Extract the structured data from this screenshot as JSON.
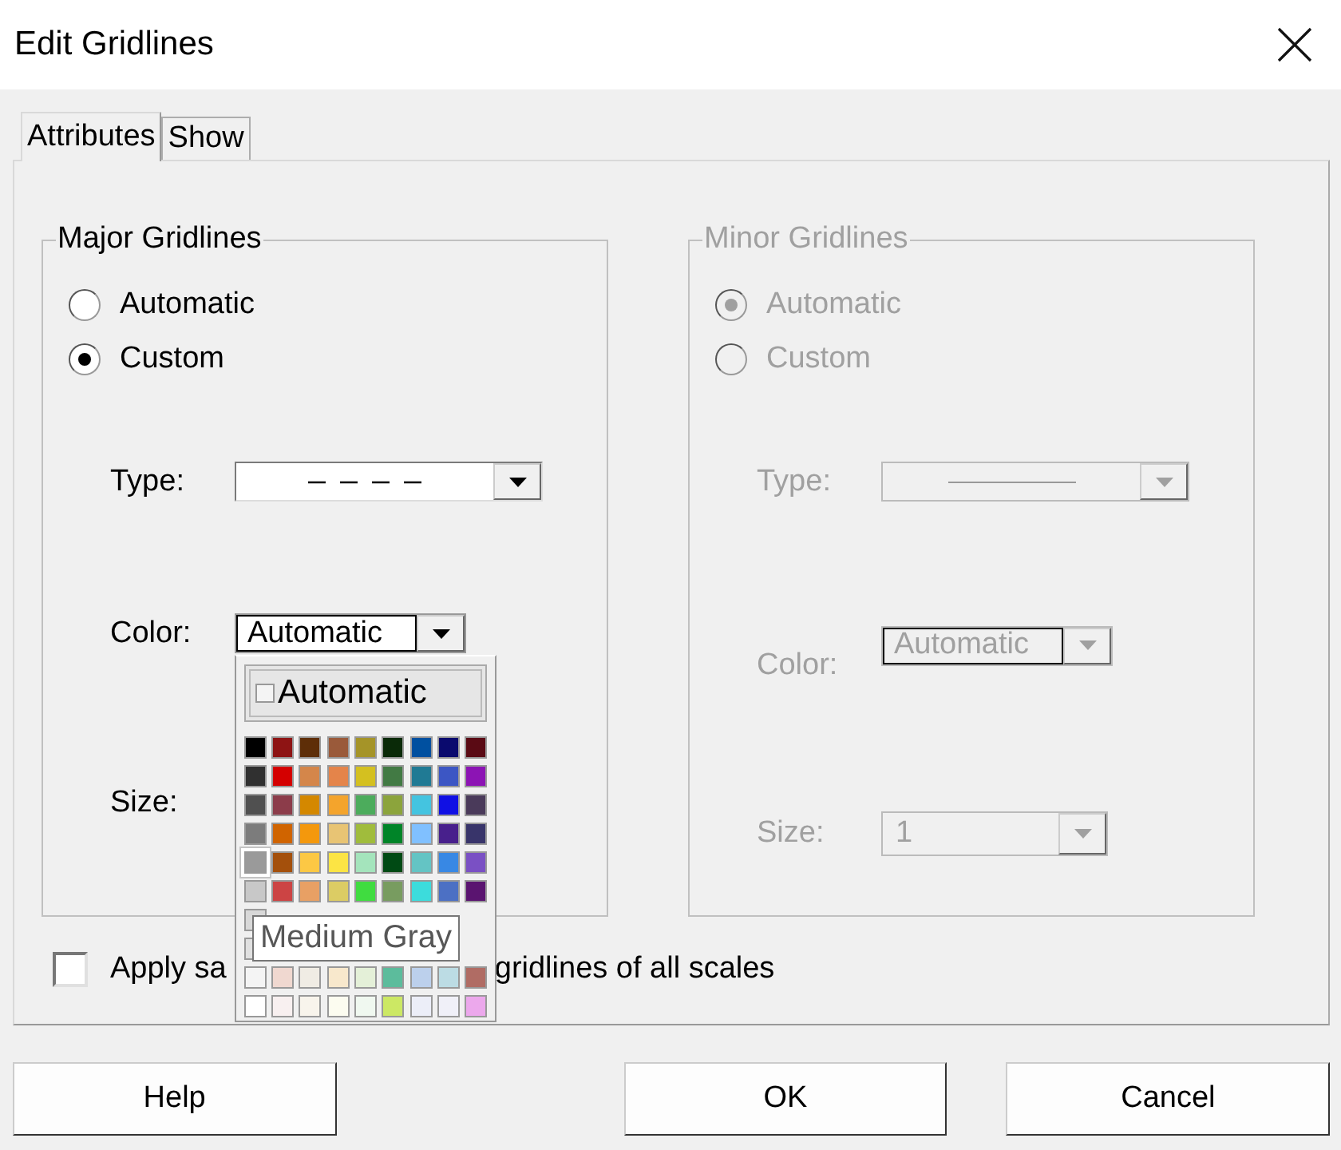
{
  "window": {
    "title": "Edit Gridlines"
  },
  "tabs": [
    {
      "label": "Attributes",
      "selected": true
    },
    {
      "label": "Show",
      "selected": false
    }
  ],
  "groups": [
    {
      "title": "Major Gridlines",
      "disabled": false,
      "options": [
        {
          "label": "Automatic",
          "selected": false
        },
        {
          "label": "Custom",
          "selected": true
        }
      ],
      "type": {
        "label": "Type:",
        "dashed": true
      },
      "color": {
        "label": "Color:",
        "value": "Automatic",
        "expanded": true
      },
      "size": {
        "label": "Size:"
      }
    },
    {
      "title": "Minor Gridlines",
      "disabled": true,
      "options": [
        {
          "label": "Automatic",
          "selected": true
        },
        {
          "label": "Custom",
          "selected": false
        }
      ],
      "type": {
        "label": "Type:",
        "dashed": false
      },
      "color": {
        "label": "Color:",
        "value": "Automatic",
        "expanded": false
      },
      "size": {
        "label": "Size:",
        "value": "1"
      }
    }
  ],
  "color_popup": {
    "automatic_label": "Automatic",
    "tooltip": "Medium Gray",
    "rows": [
      [
        {
          "color": "#000000",
          "selected": false
        },
        {
          "color": "#8e1414",
          "selected": false
        },
        {
          "color": "#5e2e08",
          "selected": false
        },
        {
          "color": "#9a5a3a",
          "selected": false
        },
        {
          "color": "#a59428",
          "selected": false
        },
        {
          "color": "#0a2a08",
          "selected": false
        },
        {
          "color": "#0050a0",
          "selected": false
        },
        {
          "color": "#0a0a6e",
          "selected": false
        },
        {
          "color": "#5a0a14",
          "selected": false
        }
      ],
      [
        {
          "color": "#303030",
          "selected": false
        },
        {
          "color": "#d40000",
          "selected": false
        },
        {
          "color": "#d4864a",
          "selected": false
        },
        {
          "color": "#e4844a",
          "selected": false
        },
        {
          "color": "#d4c020",
          "selected": false
        },
        {
          "color": "#427a44",
          "selected": false
        },
        {
          "color": "#207a94",
          "selected": false
        },
        {
          "color": "#3c56c4",
          "selected": false
        },
        {
          "color": "#8c14b4",
          "selected": false
        }
      ],
      [
        {
          "color": "#505050",
          "selected": false
        },
        {
          "color": "#8c3c4a",
          "selected": false
        },
        {
          "color": "#d48800",
          "selected": false
        },
        {
          "color": "#f4a42c",
          "selected": false
        },
        {
          "color": "#4cac5c",
          "selected": false
        },
        {
          "color": "#8ca43c",
          "selected": false
        },
        {
          "color": "#44c4e0",
          "selected": false
        },
        {
          "color": "#1010e4",
          "selected": false
        },
        {
          "color": "#4a3a5a",
          "selected": false
        }
      ],
      [
        {
          "color": "#7c7c7c",
          "selected": false
        },
        {
          "color": "#d06400",
          "selected": false
        },
        {
          "color": "#f4980c",
          "selected": false
        },
        {
          "color": "#e8c474",
          "selected": false
        },
        {
          "color": "#a0bc3c",
          "selected": false
        },
        {
          "color": "#008428",
          "selected": false
        },
        {
          "color": "#80c0ff",
          "selected": false
        },
        {
          "color": "#48208c",
          "selected": false
        },
        {
          "color": "#38346a",
          "selected": false
        }
      ],
      [
        {
          "color": "#9a9a9a",
          "selected": true
        },
        {
          "color": "#a4500c",
          "selected": false
        },
        {
          "color": "#fcc844",
          "selected": false
        },
        {
          "color": "#fce444",
          "selected": false
        },
        {
          "color": "#a4e4bc",
          "selected": false
        },
        {
          "color": "#004a14",
          "selected": false
        },
        {
          "color": "#64c4c4",
          "selected": false
        },
        {
          "color": "#3888e4",
          "selected": false
        },
        {
          "color": "#7a50c4",
          "selected": false
        }
      ],
      [
        {
          "color": "#c8c8c8",
          "selected": false
        },
        {
          "color": "#cc4444",
          "selected": false
        },
        {
          "color": "#e8a064",
          "selected": false
        },
        {
          "color": "#dccc64",
          "selected": false
        },
        {
          "color": "#40dc40",
          "selected": false
        },
        {
          "color": "#789c60",
          "selected": false
        },
        {
          "color": "#3cdcdc",
          "selected": false
        },
        {
          "color": "#4c70c4",
          "selected": false
        },
        {
          "color": "#5a1470",
          "selected": false
        }
      ],
      [
        {
          "color": "#d8d8d8",
          "selected": false
        }
      ],
      [
        {
          "color": "#e0e0e0",
          "selected": false
        }
      ],
      [
        {
          "color": "#f4f4f4",
          "selected": false
        },
        {
          "color": "#f0d8d0",
          "selected": false
        },
        {
          "color": "#f0ece4",
          "selected": false
        },
        {
          "color": "#f8e8cc",
          "selected": false
        },
        {
          "color": "#e4f0d8",
          "selected": false
        },
        {
          "color": "#5cbc9c",
          "selected": false
        },
        {
          "color": "#bcd0ec",
          "selected": false
        },
        {
          "color": "#bcdce4",
          "selected": false
        },
        {
          "color": "#b06c64",
          "selected": false
        }
      ],
      [
        {
          "color": "#ffffff",
          "selected": false
        },
        {
          "color": "#f8f0f0",
          "selected": false
        },
        {
          "color": "#f8f4ec",
          "selected": false
        },
        {
          "color": "#fcfcf0",
          "selected": false
        },
        {
          "color": "#f0f8f0",
          "selected": false
        },
        {
          "color": "#cce864",
          "selected": false
        },
        {
          "color": "#eceef8",
          "selected": false
        },
        {
          "color": "#f0f0f8",
          "selected": false
        },
        {
          "color": "#eca8ec",
          "selected": false
        }
      ]
    ]
  },
  "apply_checkbox": {
    "checked": false,
    "label_start": "Apply sa",
    "label_end": "gridlines of all scales"
  },
  "buttons": [
    {
      "label": "Help"
    },
    {
      "label": "OK"
    },
    {
      "label": "Cancel"
    }
  ]
}
